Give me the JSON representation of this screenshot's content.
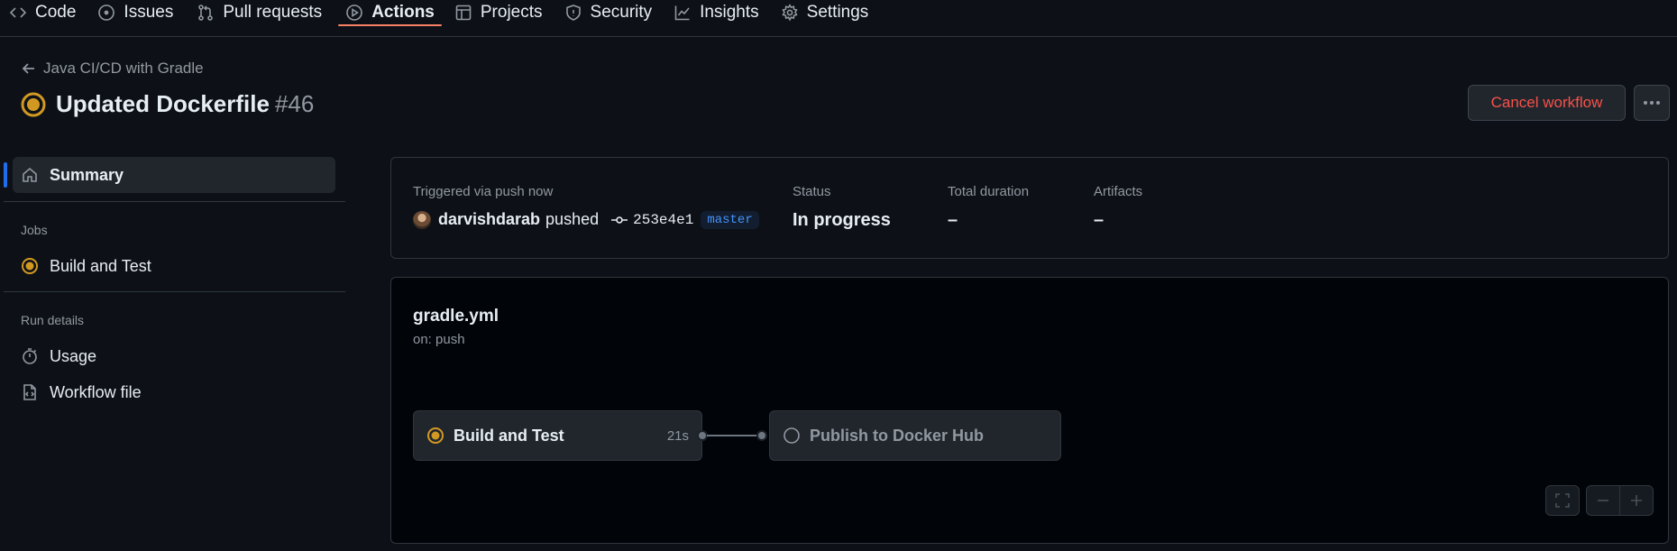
{
  "nav": {
    "tabs": [
      {
        "label": "Code",
        "icon": "code-icon"
      },
      {
        "label": "Issues",
        "icon": "issue-icon"
      },
      {
        "label": "Pull requests",
        "icon": "pull-request-icon"
      },
      {
        "label": "Actions",
        "icon": "play-icon",
        "active": true
      },
      {
        "label": "Projects",
        "icon": "table-icon"
      },
      {
        "label": "Security",
        "icon": "shield-icon"
      },
      {
        "label": "Insights",
        "icon": "graph-icon"
      },
      {
        "label": "Settings",
        "icon": "gear-icon"
      }
    ]
  },
  "header": {
    "back_label": "Java CI/CD with Gradle",
    "title": "Updated Dockerfile",
    "run_number": "#46",
    "cancel_label": "Cancel workflow"
  },
  "sidebar": {
    "summary_label": "Summary",
    "jobs_heading": "Jobs",
    "jobs": [
      {
        "label": "Build and Test",
        "status": "in_progress"
      }
    ],
    "run_details_heading": "Run details",
    "details": [
      {
        "label": "Usage",
        "icon": "stopwatch-icon"
      },
      {
        "label": "Workflow file",
        "icon": "file-code-icon"
      }
    ]
  },
  "summary": {
    "trigger_label": "Triggered via push now",
    "actor": "darvishdarab",
    "pushed_text": "pushed",
    "commit": "253e4e1",
    "branch": "master",
    "status_label": "Status",
    "status_value": "In progress",
    "duration_label": "Total duration",
    "duration_value": "–",
    "artifacts_label": "Artifacts",
    "artifacts_value": "–"
  },
  "graph": {
    "file": "gradle.yml",
    "trigger": "on: push",
    "jobs": [
      {
        "name": "Build and Test",
        "duration": "21s",
        "status": "in_progress"
      },
      {
        "name": "Publish to Docker Hub",
        "duration": "",
        "status": "pending"
      }
    ]
  },
  "colors": {
    "accent": "#f78166",
    "in_progress": "#d29922",
    "danger": "#f85149",
    "link": "#4493f8"
  }
}
